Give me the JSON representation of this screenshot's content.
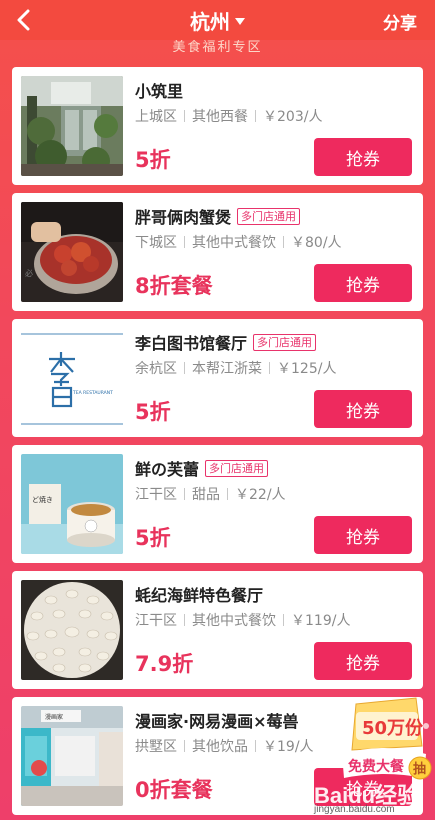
{
  "header": {
    "city": "杭州",
    "share_label": "分享",
    "section_title": "美食福利专区"
  },
  "colors": {
    "header_bg": "#f34a3f",
    "accent": "#ee2a5e",
    "discount_text": "#e8335c"
  },
  "items": [
    {
      "name": "小筑里",
      "tag": "",
      "district": "上城区",
      "category": "其他西餐",
      "price": "￥203/人",
      "discount": "5折",
      "button": "抢券",
      "thumb": "garden-restaurant-photo"
    },
    {
      "name": "胖哥俩肉蟹煲",
      "tag": "多门店通用",
      "district": "下城区",
      "category": "其他中式餐饮",
      "price": "￥80/人",
      "discount": "8折套餐",
      "button": "抢券",
      "thumb": "crab-pot-photo"
    },
    {
      "name": "李白图书馆餐厅",
      "tag": "多门店通用",
      "district": "余杭区",
      "category": "本帮江浙菜",
      "price": "￥125/人",
      "discount": "5折",
      "button": "抢券",
      "thumb": "libai-logo",
      "logo_text": "TEA RESTAURANT"
    },
    {
      "name": "鲜の芙蕾",
      "tag": "多门店通用",
      "district": "江干区",
      "category": "甜品",
      "price": "￥22/人",
      "discount": "5折",
      "button": "抢券",
      "thumb": "pudding-cup-photo"
    },
    {
      "name": "蚝纪海鲜特色餐厅",
      "tag": "",
      "district": "江干区",
      "category": "其他中式餐饮",
      "price": "￥119/人",
      "discount": "7.9折",
      "button": "抢券",
      "thumb": "oyster-platter-photo"
    },
    {
      "name": "漫画家·网易漫画×莓兽",
      "tag": "",
      "district": "拱墅区",
      "category": "其他饮品",
      "price": "￥19/人",
      "discount": "0折套餐",
      "button": "抢券",
      "thumb": "comic-cafe-photo"
    }
  ],
  "float_ad": {
    "amount": "50万份",
    "label": "免费大餐",
    "action": "抽"
  },
  "watermark": {
    "logo": "Baidu经验",
    "url": "jingyan.baidu.com"
  }
}
